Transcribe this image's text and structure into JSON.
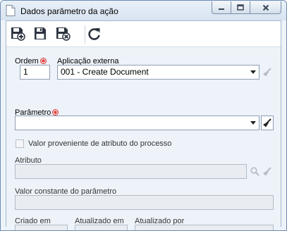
{
  "window": {
    "title": "Dados parâmetro da ação"
  },
  "toolbar": {
    "save_new_tooltip": "Salvar e novo",
    "save_tooltip": "Salvar",
    "save_close_tooltip": "Salvar e sair",
    "refresh_tooltip": "Atualizar"
  },
  "form": {
    "order": {
      "label": "Ordem",
      "value": "1",
      "required": true
    },
    "external_app": {
      "label": "Aplicação externa",
      "value": "001 - Create Document"
    },
    "parameter": {
      "label": "Parâmetro",
      "value": "",
      "required": true
    },
    "from_process_attribute": {
      "label": "Valor proveniente de atributo do processo",
      "checked": false
    },
    "attribute": {
      "label": "Atributo",
      "value": ""
    },
    "constant_value": {
      "label": "Valor constante do parâmetro",
      "value": ""
    },
    "created_on": {
      "label": "Criado em",
      "value": ""
    },
    "updated_on": {
      "label": "Atualizado em",
      "value": ""
    },
    "updated_by": {
      "label": "Atualizado por",
      "value": ""
    }
  },
  "colors": {
    "required_marker": "#e0302a",
    "form_background": "#eef3f9",
    "window_border": "#6c8cb5"
  }
}
